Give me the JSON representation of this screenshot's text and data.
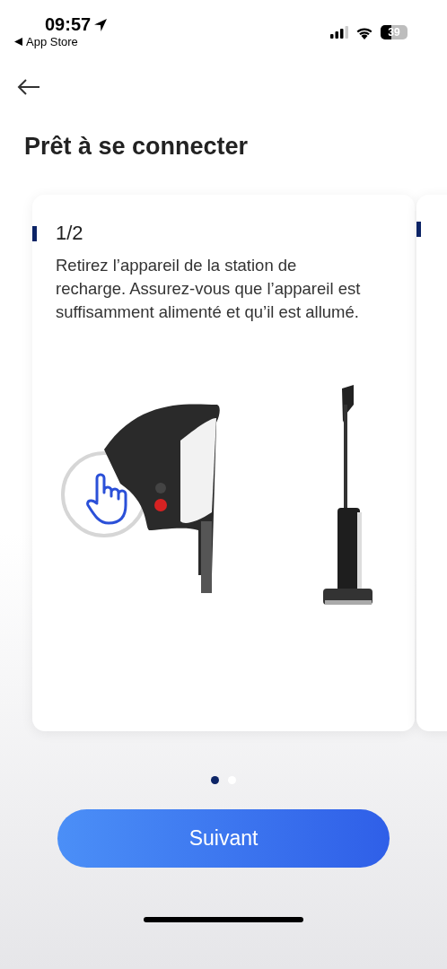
{
  "status_bar": {
    "time": "09:57",
    "back_app": "App Store",
    "battery": "39"
  },
  "title": "Prêt à se connecter",
  "cards": [
    {
      "step": "1/2",
      "lines": [
        "Retirez l’appareil de la station de recharge. Assurez-vous que l’appareil est suffisamment alimenté et qu’il est allumé."
      ]
    }
  ],
  "pager": [
    {
      "selected": true
    },
    {
      "selected": false
    }
  ],
  "button": "Suivant"
}
